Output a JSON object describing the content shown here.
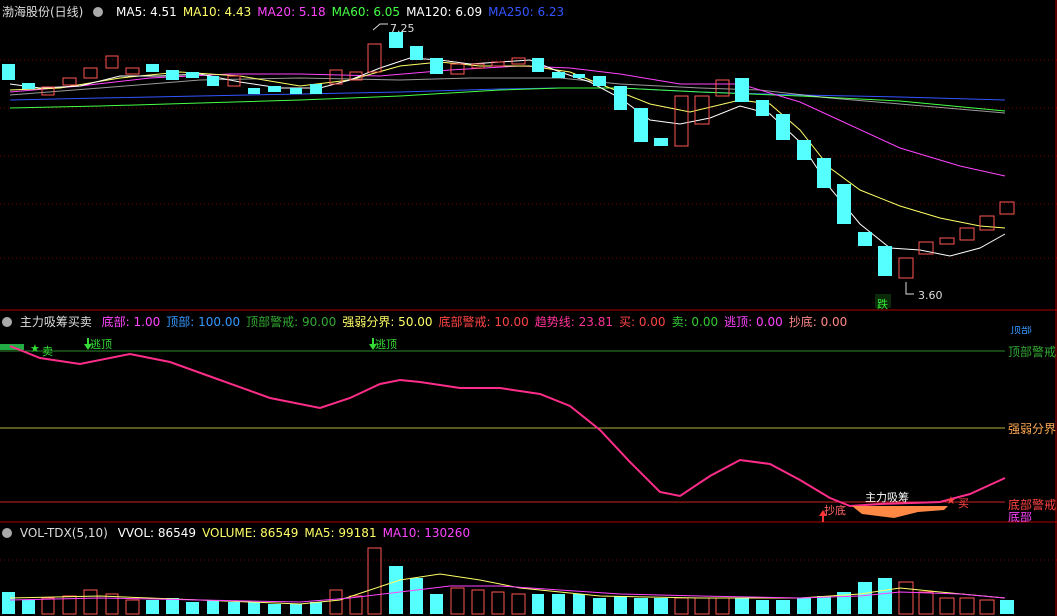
{
  "main_panel": {
    "title": "渤海股份(日线)",
    "indicators": [
      {
        "label": "MA5: 4.51",
        "color": "#ffffff"
      },
      {
        "label": "MA10: 4.43",
        "color": "#ffff66"
      },
      {
        "label": "MA20: 5.18",
        "color": "#ff44ff"
      },
      {
        "label": "MA60: 6.05",
        "color": "#44ff44"
      },
      {
        "label": "MA120: 6.09",
        "color": "#ffffff"
      },
      {
        "label": "MA250: 6.23",
        "color": "#3355ff"
      }
    ],
    "high_label": "7.25",
    "low_label": "3.60",
    "fall_tag": "跌"
  },
  "indicator_panel": {
    "title": "主力吸筹买卖",
    "values": [
      {
        "label": "底部: 1.00",
        "color": "#ff44ff"
      },
      {
        "label": "顶部: 100.00",
        "color": "#3399ff"
      },
      {
        "label": "顶部警戒: 90.00",
        "color": "#33aa33"
      },
      {
        "label": "强弱分界: 50.00",
        "color": "#ffff66"
      },
      {
        "label": "底部警戒: 10.00",
        "color": "#ff4444"
      },
      {
        "label": "趋势线: 23.81",
        "color": "#ff3399"
      },
      {
        "label": "买: 0.00",
        "color": "#ff4444"
      },
      {
        "label": "卖: 0.00",
        "color": "#33cc33"
      },
      {
        "label": "逃顶: 0.00",
        "color": "#ff44ff"
      },
      {
        "label": "抄底: 0.00",
        "color": "#ff8888"
      }
    ],
    "right_labels": {
      "top": "顶部",
      "top_warn": "顶部警戒",
      "mid": "强弱分界",
      "bottom_warn": "底部警戒",
      "bottom": "底部"
    },
    "annotations": {
      "sell": "卖",
      "escape1": "逃顶",
      "escape2": "逃顶",
      "bottom_buy": "抄底",
      "accumulate": "主力吸筹",
      "buy": "买"
    }
  },
  "volume_panel": {
    "title": "VOL-TDX(5,10)",
    "values": [
      {
        "label": "VVOL: 86549",
        "color": "#ffffff"
      },
      {
        "label": "VOLUME: 86549",
        "color": "#ffff66"
      },
      {
        "label": "MA5: 99181",
        "color": "#ffff66"
      },
      {
        "label": "MA10: 130260",
        "color": "#ff44ff"
      }
    ]
  }
}
